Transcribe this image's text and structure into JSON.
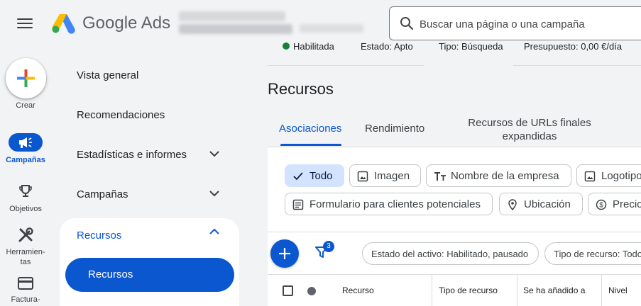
{
  "app": {
    "brand": "Google Ads"
  },
  "search": {
    "placeholder": "Buscar una página o una campaña"
  },
  "rail": {
    "create": "Crear",
    "campaigns": "Campañas",
    "goals": "Objetivos",
    "tools_line1": "Herramien-",
    "tools_line2": "tas",
    "billing": "Factura-"
  },
  "nav": {
    "overview": "Vista general",
    "recommendations": "Recomendaciones",
    "insights": "Estadísticas e informes",
    "campaigns": "Campañas",
    "assets": "Recursos",
    "assets_sub": "Recursos"
  },
  "summary": {
    "status": "Habilitada",
    "state": "Estado: Apto",
    "type": "Tipo: Búsqueda",
    "budget": "Presupuesto: 0,00 €/día"
  },
  "page": {
    "title": "Recursos"
  },
  "tabs": [
    {
      "label": "Asociaciones"
    },
    {
      "label": "Rendimiento"
    },
    {
      "label_line1": "Recursos de URLs finales",
      "label_line2": "expandidas"
    }
  ],
  "filter_chips": [
    {
      "label": "Todo",
      "icon": "check-icon",
      "selected": true
    },
    {
      "label": "Imagen",
      "icon": "image-icon"
    },
    {
      "label": "Nombre de la empresa",
      "icon": "text-icon"
    },
    {
      "label": "Logotipo",
      "icon": "image-icon"
    },
    {
      "label": "Formulario para clientes potenciales",
      "icon": "form-icon"
    },
    {
      "label": "Ubicación",
      "icon": "location-icon"
    },
    {
      "label": "Precio",
      "icon": "price-icon"
    }
  ],
  "toolbar": {
    "filter_count": "3",
    "filters": [
      "Estado del activo: Habilitado, pausado",
      "Tipo de recurso: Todo"
    ]
  },
  "table": {
    "columns": [
      "Recurso",
      "Tipo de recurso",
      "Se ha añadido a",
      "Nivel"
    ]
  },
  "colors": {
    "accent": "#0b57d0",
    "selected_chip": "#d3e3fd",
    "background": "#f1f3f4",
    "status_green": "#188038"
  }
}
